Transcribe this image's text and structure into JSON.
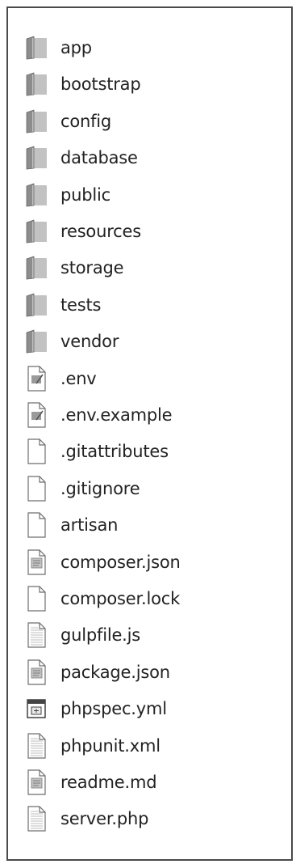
{
  "colors": {
    "folder_back": "#8c8c8c",
    "folder_front": "#c2c2c2",
    "page_fill": "#ffffff",
    "page_stroke": "#6e6e6e",
    "text": "#222222"
  },
  "files": [
    {
      "name": "app",
      "icon": "folder-icon"
    },
    {
      "name": "bootstrap",
      "icon": "folder-icon"
    },
    {
      "name": "config",
      "icon": "folder-icon"
    },
    {
      "name": "database",
      "icon": "folder-icon"
    },
    {
      "name": "public",
      "icon": "folder-icon"
    },
    {
      "name": "resources",
      "icon": "folder-icon"
    },
    {
      "name": "storage",
      "icon": "folder-icon"
    },
    {
      "name": "tests",
      "icon": "folder-icon"
    },
    {
      "name": "vendor",
      "icon": "folder-icon"
    },
    {
      "name": ".env",
      "icon": "env-file-icon"
    },
    {
      "name": ".env.example",
      "icon": "env-file-icon"
    },
    {
      "name": ".gitattributes",
      "icon": "blank-file-icon"
    },
    {
      "name": ".gitignore",
      "icon": "blank-file-icon"
    },
    {
      "name": "artisan",
      "icon": "blank-file-icon"
    },
    {
      "name": "composer.json",
      "icon": "document-file-icon"
    },
    {
      "name": "composer.lock",
      "icon": "blank-file-icon"
    },
    {
      "name": "gulpfile.js",
      "icon": "text-file-icon"
    },
    {
      "name": "package.json",
      "icon": "document-file-icon"
    },
    {
      "name": "phpspec.yml",
      "icon": "config-file-icon"
    },
    {
      "name": "phpunit.xml",
      "icon": "text-file-icon"
    },
    {
      "name": "readme.md",
      "icon": "document-file-icon"
    },
    {
      "name": "server.php",
      "icon": "text-file-icon"
    }
  ]
}
